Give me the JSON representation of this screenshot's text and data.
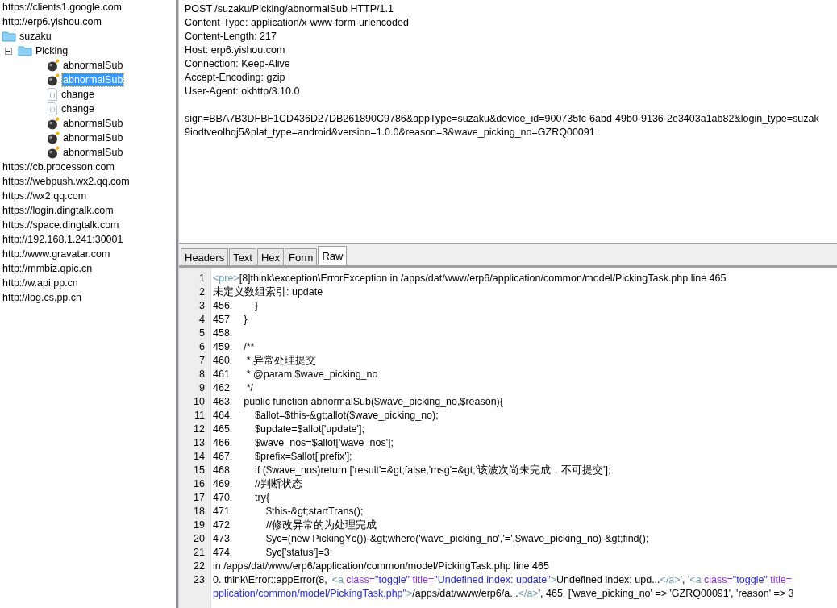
{
  "sidebar": {
    "items": [
      {
        "kind": "host",
        "label": "https://clients1.google.com"
      },
      {
        "kind": "host",
        "label": "http://erp6.yishou.com"
      },
      {
        "kind": "folder",
        "label": "suzaku",
        "children": [
          {
            "kind": "folder",
            "label": "Picking",
            "expanded": true,
            "children": [
              {
                "kind": "error",
                "label": "abnormalSub",
                "selected": false
              },
              {
                "kind": "error",
                "label": "abnormalSub",
                "selected": true
              },
              {
                "kind": "json",
                "label": "change",
                "selected": false
              },
              {
                "kind": "json",
                "label": "change",
                "selected": false
              },
              {
                "kind": "error",
                "label": "abnormalSub",
                "selected": false
              },
              {
                "kind": "error",
                "label": "abnormalSub",
                "selected": false
              },
              {
                "kind": "error",
                "label": "abnormalSub",
                "selected": false
              }
            ]
          }
        ]
      },
      {
        "kind": "host",
        "label": "https://cb.processon.com"
      },
      {
        "kind": "host",
        "label": "https://webpush.wx2.qq.com"
      },
      {
        "kind": "host",
        "label": "https://wx2.qq.com"
      },
      {
        "kind": "host",
        "label": "https://login.dingtalk.com"
      },
      {
        "kind": "host",
        "label": "https://space.dingtalk.com"
      },
      {
        "kind": "host",
        "label": "http://192.168.1.241:30001"
      },
      {
        "kind": "host",
        "label": "http://www.gravatar.com"
      },
      {
        "kind": "host",
        "label": "http://mmbiz.qpic.cn"
      },
      {
        "kind": "host",
        "label": "http://w.api.pp.cn"
      },
      {
        "kind": "host",
        "label": "http://log.cs.pp.cn"
      }
    ]
  },
  "request": {
    "lines": [
      "POST /suzaku/Picking/abnormalSub HTTP/1.1",
      "Content-Type: application/x-www-form-urlencoded",
      "Content-Length: 217",
      "Host: erp6.yishou.com",
      "Connection: Keep-Alive",
      "Accept-Encoding: gzip",
      "User-Agent: okhttp/3.10.0"
    ],
    "body_lines": [
      "sign=BBA7B3DFBF1CD436D27DB261890C9786&appType=suzaku&device_id=900735fc-6abd-49b0-9136-2e3403a1ab82&login_type=suzak",
      "9iodtveolhqj5&plat_type=android&version=1.0.0&reason=3&wave_picking_no=GZRQ00091"
    ]
  },
  "response_tabs": [
    {
      "label": "Headers",
      "selected": false
    },
    {
      "label": "Text",
      "selected": false
    },
    {
      "label": "Hex",
      "selected": false
    },
    {
      "label": "Form",
      "selected": false
    },
    {
      "label": "Raw",
      "selected": true
    }
  ],
  "response": {
    "lines": [
      {
        "number": "1",
        "segments": [
          {
            "kind": "tag",
            "text": "<pre>"
          },
          {
            "kind": "text",
            "text": "[8]think\\exception\\ErrorException in /apps/dat/www/erp6/application/common/model/PickingTask.php line 465"
          }
        ]
      },
      {
        "number": "2",
        "segments": [
          {
            "kind": "text",
            "text": "未定义数组索引: update"
          }
        ]
      },
      {
        "number": "3",
        "segments": [
          {
            "kind": "text",
            "text": "456.        }"
          }
        ]
      },
      {
        "number": "4",
        "segments": [
          {
            "kind": "text",
            "text": "457.    }"
          }
        ]
      },
      {
        "number": "5",
        "segments": [
          {
            "kind": "text",
            "text": "458."
          }
        ]
      },
      {
        "number": "6",
        "segments": [
          {
            "kind": "text",
            "text": "459.    /**"
          }
        ]
      },
      {
        "number": "7",
        "segments": [
          {
            "kind": "text",
            "text": "460.     * 异常处理提交"
          }
        ]
      },
      {
        "number": "8",
        "segments": [
          {
            "kind": "text",
            "text": "461.     * @param $wave_picking_no"
          }
        ]
      },
      {
        "number": "9",
        "segments": [
          {
            "kind": "text",
            "text": "462.     */"
          }
        ]
      },
      {
        "number": "10",
        "segments": [
          {
            "kind": "text",
            "text": "463.    public function abnormalSub($wave_picking_no,$reason){"
          }
        ]
      },
      {
        "number": "11",
        "segments": [
          {
            "kind": "text",
            "text": "464.        $allot=$this-&gt;allot($wave_picking_no);"
          }
        ]
      },
      {
        "number": "12",
        "segments": [
          {
            "kind": "text",
            "text": "465.        $update=$allot['update'];"
          }
        ]
      },
      {
        "number": "13",
        "segments": [
          {
            "kind": "text",
            "text": "466.        $wave_nos=$allot['wave_nos'];"
          }
        ]
      },
      {
        "number": "14",
        "segments": [
          {
            "kind": "text",
            "text": "467.        $prefix=$allot['prefix'];"
          }
        ]
      },
      {
        "number": "15",
        "segments": [
          {
            "kind": "text",
            "text": "468.        if ($wave_nos)return ['result'=&gt;false,'msg'=&gt;'该波次尚未完成，不可提交'];"
          }
        ]
      },
      {
        "number": "16",
        "segments": [
          {
            "kind": "text",
            "text": "469.        //判断状态"
          }
        ]
      },
      {
        "number": "17",
        "segments": [
          {
            "kind": "text",
            "text": "470.        try{"
          }
        ]
      },
      {
        "number": "18",
        "segments": [
          {
            "kind": "text",
            "text": "471.            $this-&gt;startTrans();"
          }
        ]
      },
      {
        "number": "19",
        "segments": [
          {
            "kind": "text",
            "text": "472.            //修改异常的为处理完成"
          }
        ]
      },
      {
        "number": "20",
        "segments": [
          {
            "kind": "text",
            "text": "473.            $yc=(new PickingYc())-&gt;where('wave_picking_no','=',$wave_picking_no)-&gt;find();"
          }
        ]
      },
      {
        "number": "21",
        "segments": [
          {
            "kind": "text",
            "text": "474.            $yc['status']=3;"
          }
        ]
      },
      {
        "number": "22",
        "segments": [
          {
            "kind": "text",
            "text": "in /apps/dat/www/erp6/application/common/model/PickingTask.php line 465"
          }
        ]
      },
      {
        "number": "23",
        "segments": [
          {
            "kind": "text",
            "text": "0. think\\Error::appError(8, '"
          },
          {
            "kind": "tag",
            "text": "<a"
          },
          {
            "kind": "attr",
            "text": " class="
          },
          {
            "kind": "value",
            "text": "\"toggle\""
          },
          {
            "kind": "attr",
            "text": " title="
          },
          {
            "kind": "value",
            "text": "\"Undefined index: update\""
          },
          {
            "kind": "tag",
            "text": ">"
          },
          {
            "kind": "text",
            "text": "Undefined index: upd..."
          },
          {
            "kind": "tag",
            "text": "</a>"
          },
          {
            "kind": "text",
            "text": "', '"
          },
          {
            "kind": "tag",
            "text": "<a"
          },
          {
            "kind": "attr",
            "text": " class="
          },
          {
            "kind": "value",
            "text": "\"toggle\""
          },
          {
            "kind": "attr",
            "text": " title="
          }
        ],
        "continuation": [
          {
            "kind": "value",
            "text": "pplication/common/model/PickingTask.php\""
          },
          {
            "kind": "tag",
            "text": ">"
          },
          {
            "kind": "text",
            "text": "/apps/dat/www/erp6/a..."
          },
          {
            "kind": "tag",
            "text": "</a>"
          },
          {
            "kind": "text",
            "text": "', 465, ['wave_picking_no' => 'GZRQ00091', 'reason' => 3"
          }
        ]
      }
    ]
  }
}
